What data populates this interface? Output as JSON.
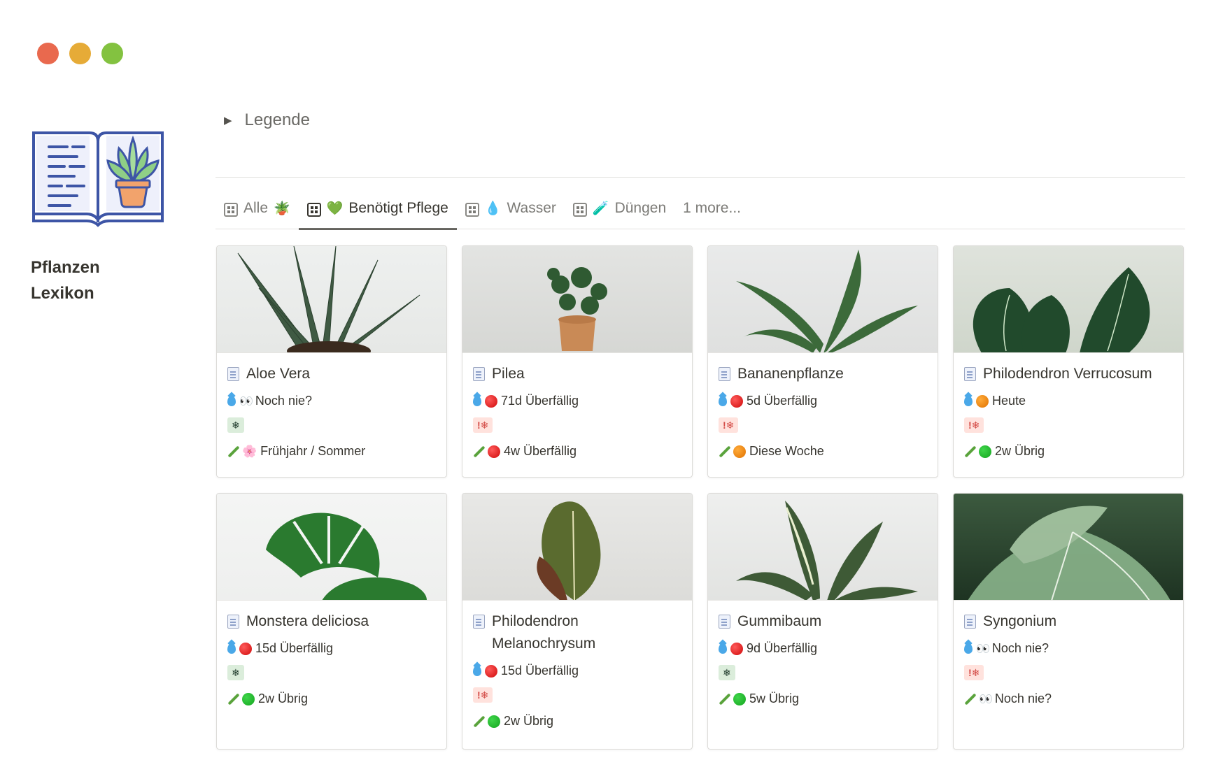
{
  "window": {
    "controls": [
      "close",
      "minimize",
      "maximize"
    ]
  },
  "page": {
    "title_line1": "Pflanzen",
    "title_line2": "Lexikon",
    "icon": "plant-book-icon"
  },
  "toggle": {
    "label": "Legende"
  },
  "tabs": [
    {
      "label": "Alle",
      "emoji": "🪴",
      "active": false
    },
    {
      "label": "Benötigt Pflege",
      "emoji": "💚",
      "active": true
    },
    {
      "label": "Wasser",
      "emoji": "💧",
      "active": false
    },
    {
      "label": "Düngen",
      "emoji": "🧪",
      "active": false
    }
  ],
  "more_tabs": "1 more...",
  "colors": {
    "red": "#d44c47",
    "green_tag": "#dbeddb",
    "red_tag": "#ffe2dd",
    "accent": "#37352f"
  },
  "cards": [
    {
      "name": "Aloe Vera",
      "water_status": "none",
      "water_text": "Noch nie?",
      "tag": "❄",
      "tag_type": "green",
      "fert_status": "flower",
      "fert_text": "Frühjahr / Sommer",
      "cover": "aloe"
    },
    {
      "name": "Pilea",
      "water_status": "red",
      "water_text": "71d Überfällig",
      "tag": "!❄",
      "tag_type": "red",
      "fert_status": "red",
      "fert_text": "4w Überfällig",
      "cover": "pilea"
    },
    {
      "name": "Bananenpflanze",
      "water_status": "red",
      "water_text": "5d Überfällig",
      "tag": "!❄",
      "tag_type": "red",
      "fert_status": "orange",
      "fert_text": "Diese Woche",
      "cover": "banana"
    },
    {
      "name": "Philodendron Verrucosum",
      "water_status": "orange",
      "water_text": "Heute",
      "tag": "!❄",
      "tag_type": "red",
      "fert_status": "green",
      "fert_text": "2w Übrig",
      "cover": "philo1"
    },
    {
      "name": "Monstera deliciosa",
      "water_status": "red",
      "water_text": "15d Überfällig",
      "tag": "❄",
      "tag_type": "green",
      "fert_status": "green",
      "fert_text": "2w Übrig",
      "cover": "monstera"
    },
    {
      "name": "Philodendron Melanochrysum",
      "water_status": "red",
      "water_text": "15d Überfällig",
      "tag": "!❄",
      "tag_type": "red",
      "fert_status": "green",
      "fert_text": "2w Übrig",
      "cover": "philo2"
    },
    {
      "name": "Gummibaum",
      "water_status": "red",
      "water_text": "9d Überfällig",
      "tag": "❄",
      "tag_type": "green",
      "fert_status": "green",
      "fert_text": "5w Übrig",
      "cover": "gummi"
    },
    {
      "name": "Syngonium",
      "water_status": "none",
      "water_text": "Noch nie?",
      "tag": "!❄",
      "tag_type": "red",
      "fert_status": "none",
      "fert_text": "Noch nie?",
      "cover": "syngo"
    }
  ]
}
